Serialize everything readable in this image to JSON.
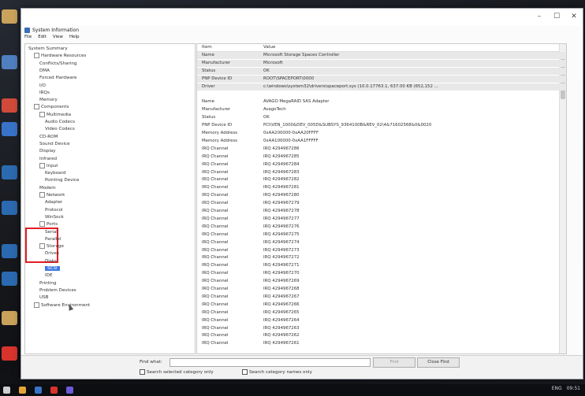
{
  "app": {
    "title": "System Information",
    "menu": [
      "File",
      "Edit",
      "View",
      "Help"
    ],
    "window_controls": [
      "–",
      "☐",
      "✕"
    ]
  },
  "tree": [
    {
      "label": "System Summary",
      "depth": 0
    },
    {
      "label": "Hardware Resources",
      "depth": 1,
      "expander": "+"
    },
    {
      "label": "Conflicts/Sharing",
      "depth": 2
    },
    {
      "label": "DMA",
      "depth": 2
    },
    {
      "label": "Forced Hardware",
      "depth": 2
    },
    {
      "label": "I/O",
      "depth": 2
    },
    {
      "label": "IRQs",
      "depth": 2
    },
    {
      "label": "Memory",
      "depth": 2
    },
    {
      "label": "Components",
      "depth": 1,
      "expander": "−"
    },
    {
      "label": "Multimedia",
      "depth": 2,
      "expander": "+"
    },
    {
      "label": "Audio Codecs",
      "depth": 3
    },
    {
      "label": "Video Codecs",
      "depth": 3
    },
    {
      "label": "CD-ROM",
      "depth": 2
    },
    {
      "label": "Sound Device",
      "depth": 2
    },
    {
      "label": "Display",
      "depth": 2
    },
    {
      "label": "Infrared",
      "depth": 2
    },
    {
      "label": "Input",
      "depth": 2,
      "expander": "+"
    },
    {
      "label": "Keyboard",
      "depth": 3
    },
    {
      "label": "Pointing Device",
      "depth": 3
    },
    {
      "label": "Modem",
      "depth": 2
    },
    {
      "label": "Network",
      "depth": 2,
      "expander": "+"
    },
    {
      "label": "Adapter",
      "depth": 3
    },
    {
      "label": "Protocol",
      "depth": 3
    },
    {
      "label": "WinSock",
      "depth": 3
    },
    {
      "label": "Ports",
      "depth": 2,
      "expander": "+"
    },
    {
      "label": "Serial",
      "depth": 3
    },
    {
      "label": "Parallel",
      "depth": 3
    },
    {
      "label": "Storage",
      "depth": 2,
      "expander": "−"
    },
    {
      "label": "Drives",
      "depth": 3
    },
    {
      "label": "Disks",
      "depth": 3
    },
    {
      "label": "SCSI",
      "depth": 3,
      "selected": true
    },
    {
      "label": "IDE",
      "depth": 3
    },
    {
      "label": "Printing",
      "depth": 2
    },
    {
      "label": "Problem Devices",
      "depth": 2
    },
    {
      "label": "USB",
      "depth": 2
    },
    {
      "label": "Software Environment",
      "depth": 1,
      "expander": "+"
    }
  ],
  "details": {
    "columns": [
      "Item",
      "Value"
    ],
    "rows": [
      [
        "Name",
        "Microsoft Storage Spaces Controller"
      ],
      [
        "Manufacturer",
        "Microsoft"
      ],
      [
        "Status",
        "OK"
      ],
      [
        "PNP Device ID",
        "ROOT\\SPACEPORT\\0000"
      ],
      [
        "Driver",
        "c:\\windows\\system32\\drivers\\spaceport.sys (10.0.17763.1, 637.00 KB (652,152 ..."
      ],
      [
        "",
        ""
      ],
      [
        "Name",
        "AVAGO MegaRAID SAS Adapter"
      ],
      [
        "Manufacturer",
        "AvagoTech"
      ],
      [
        "Status",
        "OK"
      ],
      [
        "PNP Device ID",
        "PCI\\VEN_1000&DEV_005D&SUBSYS_9364100B&REV_02\\4&71602568&0&0020"
      ],
      [
        "Memory Address",
        "0xAA200000-0xAA20FFFF"
      ],
      [
        "Memory Address",
        "0xAA100000-0xAA1FFFFF"
      ],
      [
        "IRQ Channel",
        "IRQ 4294967286"
      ],
      [
        "IRQ Channel",
        "IRQ 4294967285"
      ],
      [
        "IRQ Channel",
        "IRQ 4294967284"
      ],
      [
        "IRQ Channel",
        "IRQ 4294967283"
      ],
      [
        "IRQ Channel",
        "IRQ 4294967282"
      ],
      [
        "IRQ Channel",
        "IRQ 4294967281"
      ],
      [
        "IRQ Channel",
        "IRQ 4294967280"
      ],
      [
        "IRQ Channel",
        "IRQ 4294967279"
      ],
      [
        "IRQ Channel",
        "IRQ 4294967278"
      ],
      [
        "IRQ Channel",
        "IRQ 4294967277"
      ],
      [
        "IRQ Channel",
        "IRQ 4294967276"
      ],
      [
        "IRQ Channel",
        "IRQ 4294967275"
      ],
      [
        "IRQ Channel",
        "IRQ 4294967274"
      ],
      [
        "IRQ Channel",
        "IRQ 4294967273"
      ],
      [
        "IRQ Channel",
        "IRQ 4294967272"
      ],
      [
        "IRQ Channel",
        "IRQ 4294967271"
      ],
      [
        "IRQ Channel",
        "IRQ 4294967270"
      ],
      [
        "IRQ Channel",
        "IRQ 4294967269"
      ],
      [
        "IRQ Channel",
        "IRQ 4294967268"
      ],
      [
        "IRQ Channel",
        "IRQ 4294967267"
      ],
      [
        "IRQ Channel",
        "IRQ 4294967266"
      ],
      [
        "IRQ Channel",
        "IRQ 4294967265"
      ],
      [
        "IRQ Channel",
        "IRQ 4294967264"
      ],
      [
        "IRQ Channel",
        "IRQ 4294967263"
      ],
      [
        "IRQ Channel",
        "IRQ 4294967262"
      ],
      [
        "IRQ Channel",
        "IRQ 4294967261"
      ]
    ]
  },
  "find": {
    "label": "Find what:",
    "value": "",
    "find_button": "Find",
    "close_button": "Close Find",
    "search_selected": "Search selected category only",
    "search_names": "Search category names only"
  },
  "taskbar": {
    "tray_text": "ENG",
    "time": "09:51"
  }
}
